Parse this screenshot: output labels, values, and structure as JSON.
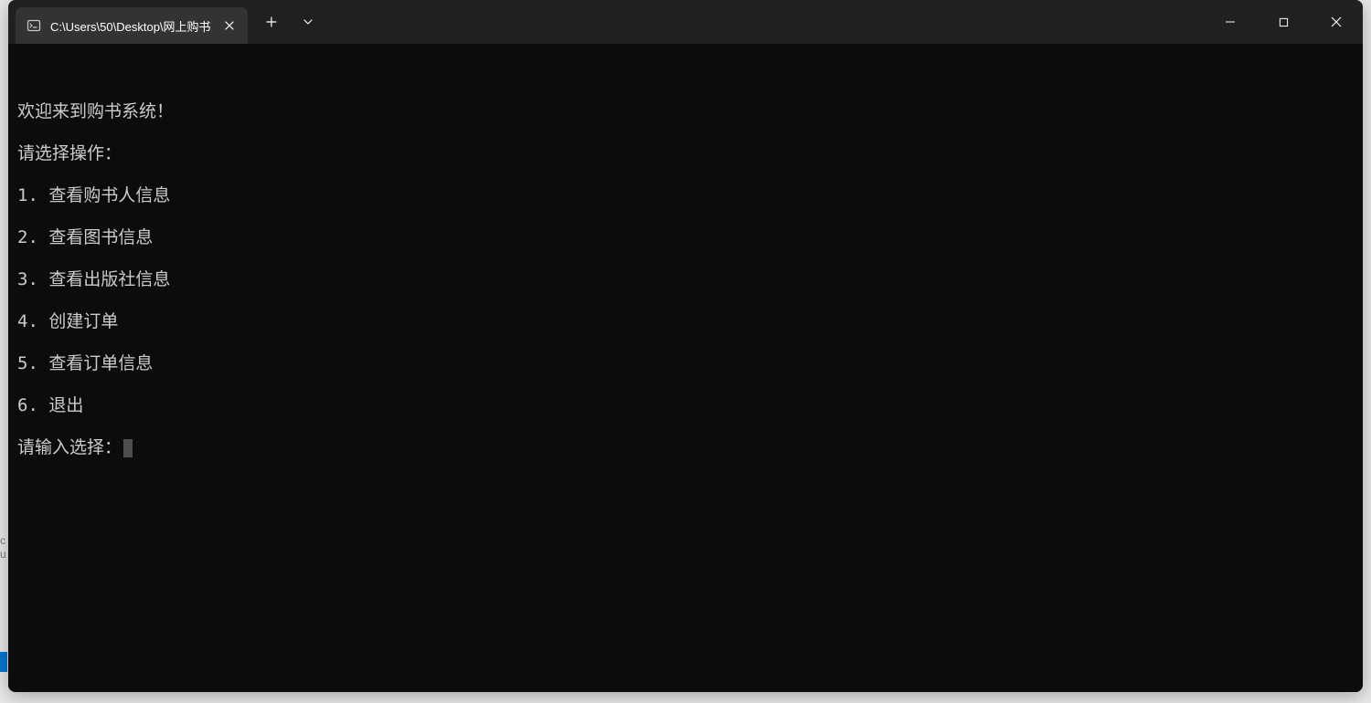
{
  "window": {
    "tab_title": "C:\\Users\\50\\Desktop\\网上购书",
    "icons": {
      "terminal": "terminal-icon",
      "close_tab": "close-icon",
      "new_tab": "plus-icon",
      "dropdown": "chevron-down-icon",
      "minimize": "minimize-icon",
      "maximize": "maximize-icon",
      "close_window": "close-icon"
    }
  },
  "terminal": {
    "welcome": "欢迎来到购书系统！",
    "instruction": "请选择操作：",
    "menu": [
      "1. 查看购书人信息",
      "2. 查看图书信息",
      "3. 查看出版社信息",
      "4. 创建订单",
      "5. 查看订单信息",
      "6. 退出"
    ],
    "prompt": "请输入选择："
  },
  "background_fragments": {
    "c": "c",
    "u": "u"
  }
}
